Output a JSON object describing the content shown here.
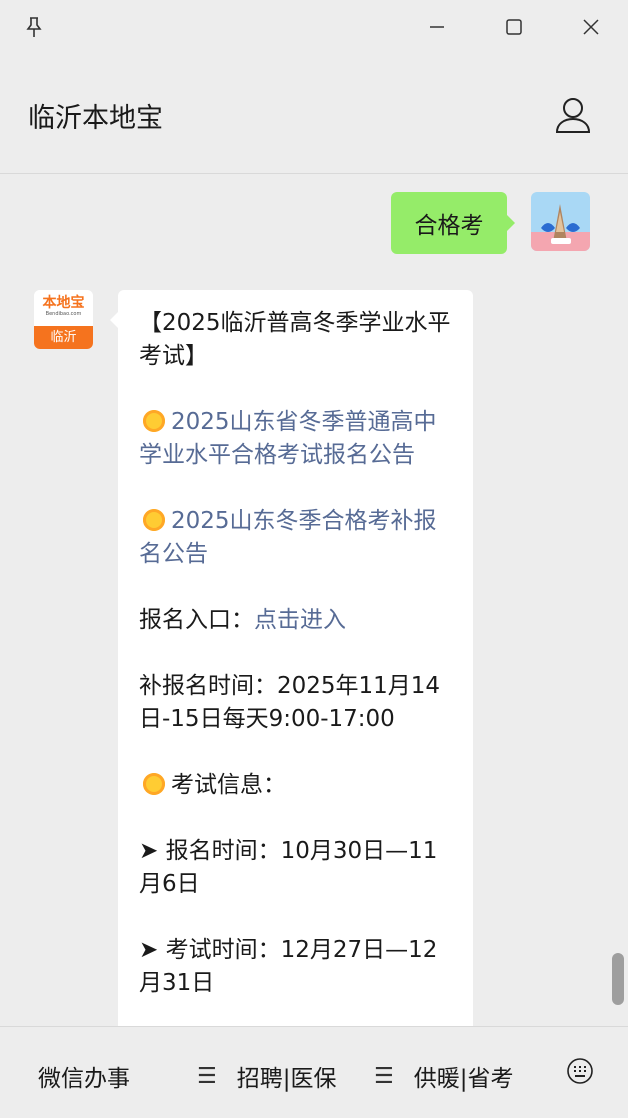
{
  "window": {
    "pin_icon": "pin-icon",
    "minimize_icon": "minimize-icon",
    "maximize_icon": "maximize-icon",
    "close_icon": "close-icon"
  },
  "header": {
    "title": "临沂本地宝",
    "profile_icon": "user-icon"
  },
  "chat": {
    "user_message": "合格考",
    "bot_avatar": {
      "logo_text": "本地宝",
      "logo_sub": "Bendibao.com",
      "city": "临沂"
    },
    "reply": {
      "heading": "【2025临沂普高冬季学业水平考试】",
      "link1": "2025山东省冬季普通高中学业水平合格考试报名公告",
      "link2": "2025山东冬季合格考补报名公告",
      "entry_label": "报名入口：",
      "entry_link": "点击进入",
      "supplement_label": "补报名时间：2025年11月14日-15日每天9:00-17:00",
      "exam_info_label": "考试信息：",
      "reg_time": "➤ 报名时间：10月30日—11月6日",
      "exam_time": "➤ 考试时间：12月27日—12月31日"
    }
  },
  "bottom_menu": {
    "item1": "微信办事",
    "item2": "招聘|医保",
    "item3": "供暖|省考",
    "menu_icon": "hamburger-icon",
    "keyboard_icon": "keyboard-icon"
  },
  "colors": {
    "background": "#ededed",
    "user_bubble": "#95ec69",
    "link": "#576b95",
    "bot_logo_orange": "#f5731e"
  }
}
